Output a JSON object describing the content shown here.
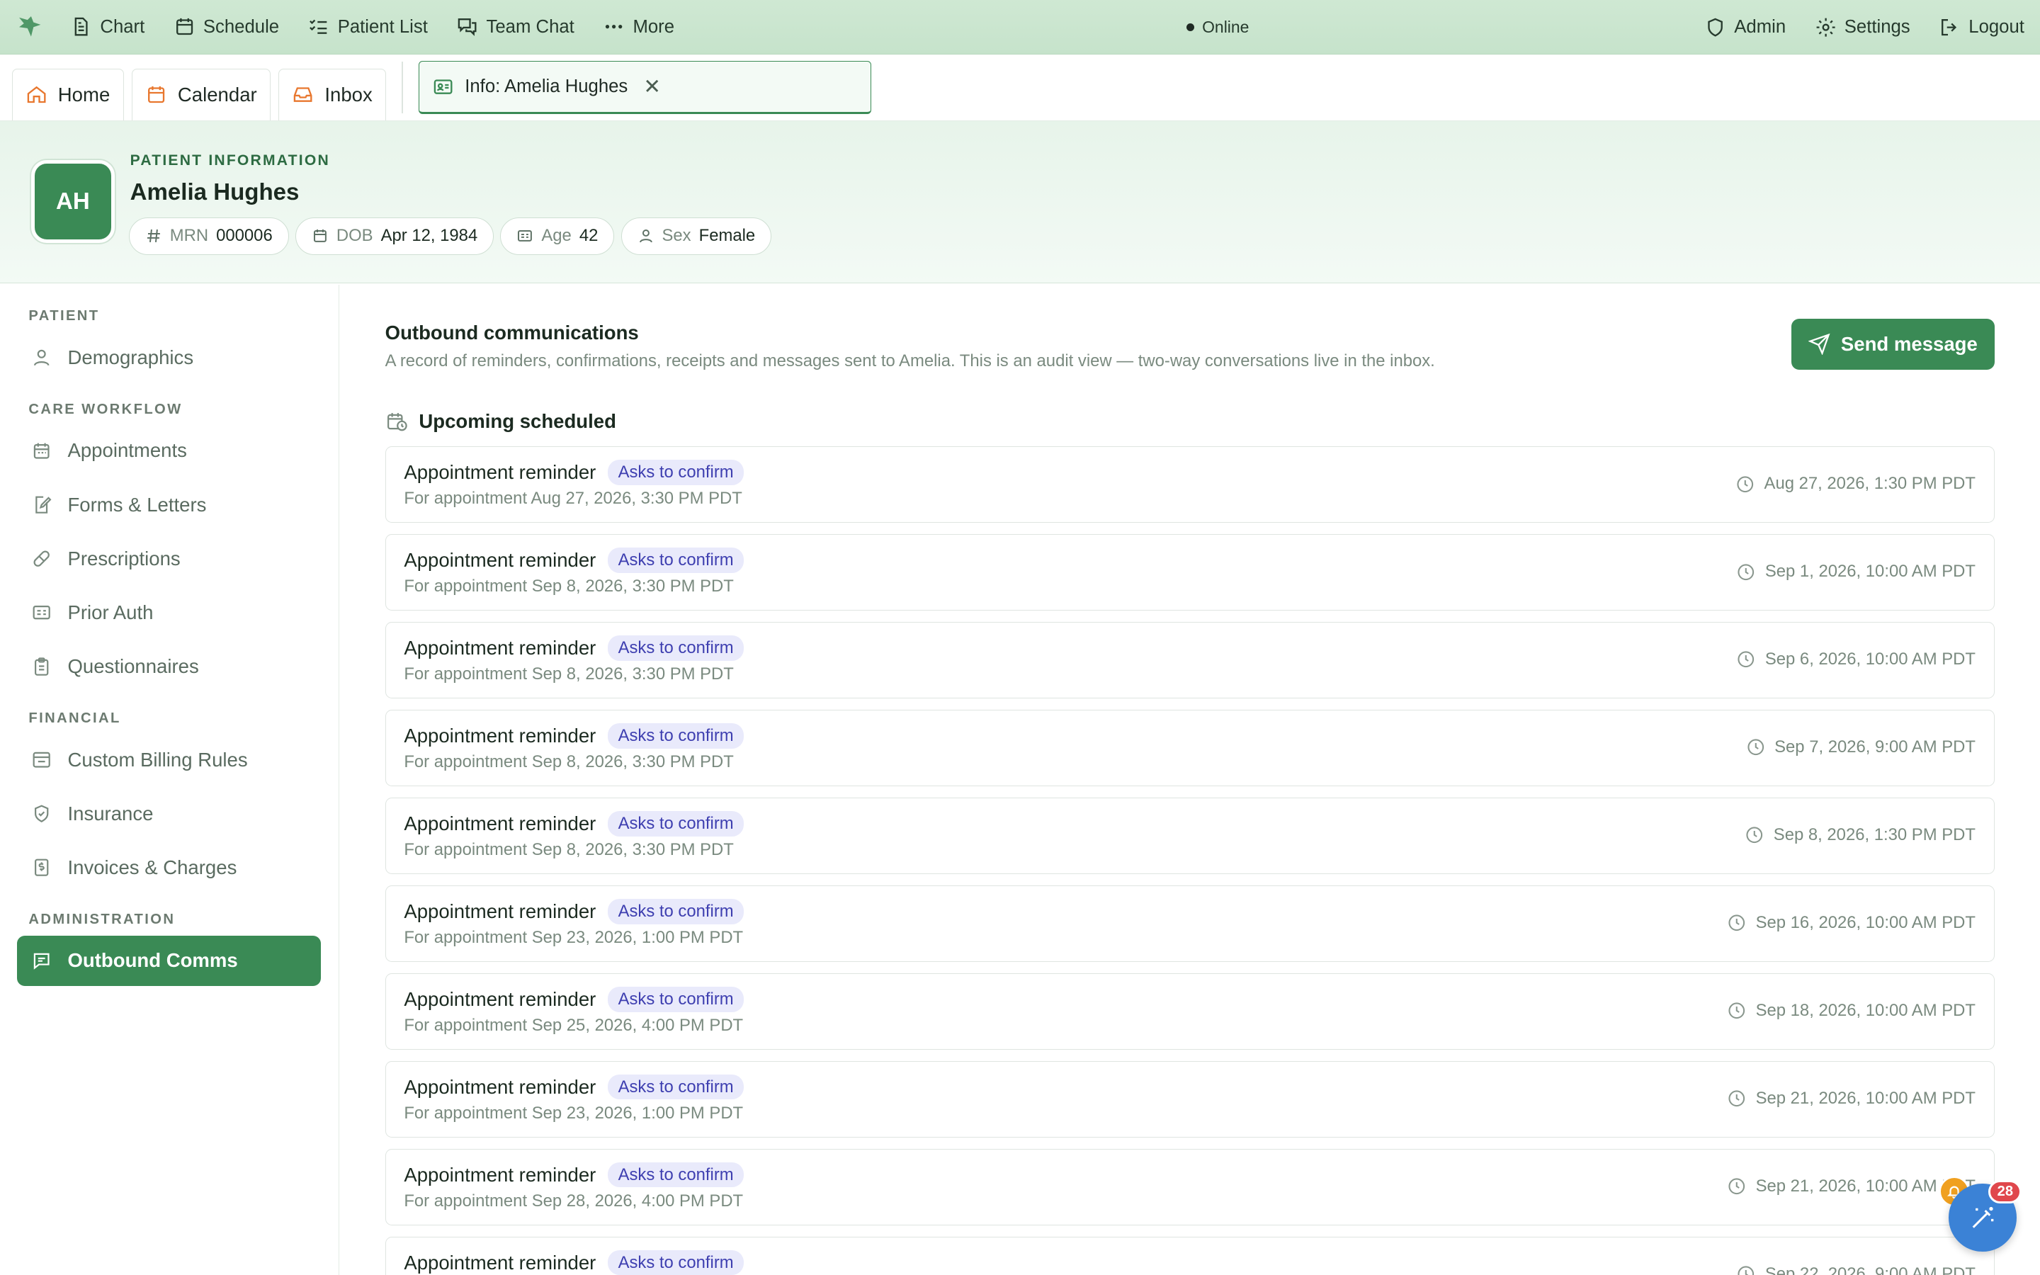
{
  "topbar": {
    "nav": [
      {
        "label": "Chart",
        "icon": "document-icon"
      },
      {
        "label": "Schedule",
        "icon": "calendar-icon"
      },
      {
        "label": "Patient List",
        "icon": "list-check-icon"
      },
      {
        "label": "Team Chat",
        "icon": "chat-bubbles-icon"
      },
      {
        "label": "More",
        "icon": "ellipsis-icon"
      }
    ],
    "status": "Online",
    "right": [
      {
        "label": "Admin",
        "icon": "shield-icon"
      },
      {
        "label": "Settings",
        "icon": "gear-icon"
      },
      {
        "label": "Logout",
        "icon": "logout-icon"
      }
    ]
  },
  "tabs": {
    "items": [
      {
        "label": "Home",
        "icon": "home-icon"
      },
      {
        "label": "Calendar",
        "icon": "calendar-icon"
      },
      {
        "label": "Inbox",
        "icon": "inbox-icon"
      }
    ],
    "active": {
      "label": "Info: Amelia Hughes",
      "icon": "id-card-icon",
      "close": "✕"
    }
  },
  "patient": {
    "section_label": "PATIENT INFORMATION",
    "initials": "AH",
    "name": "Amelia Hughes",
    "chips": {
      "mrn": {
        "key": "MRN",
        "value": "000006"
      },
      "dob": {
        "key": "DOB",
        "value": "Apr 12, 1984"
      },
      "age": {
        "key": "Age",
        "value": "42"
      },
      "sex": {
        "key": "Sex",
        "value": "Female"
      }
    }
  },
  "sidebar": {
    "sections": [
      {
        "title": "PATIENT",
        "items": [
          "Demographics"
        ]
      },
      {
        "title": "CARE WORKFLOW",
        "items": [
          "Appointments",
          "Forms & Letters",
          "Prescriptions",
          "Prior Auth",
          "Questionnaires"
        ]
      },
      {
        "title": "FINANCIAL",
        "items": [
          "Custom Billing Rules",
          "Insurance",
          "Invoices & Charges"
        ]
      },
      {
        "title": "ADMINISTRATION",
        "items": [
          "Outbound Comms"
        ]
      }
    ],
    "active": "Outbound Comms"
  },
  "main": {
    "title": "Outbound communications",
    "subtitle": "A record of reminders, confirmations, receipts and messages sent to Amelia. This is an audit view — two-way conversations live in the inbox.",
    "send_button": "Send message",
    "section_title": "Upcoming scheduled",
    "rows": [
      {
        "title": "Appointment reminder",
        "badge": "Asks to confirm",
        "sub": "For appointment Aug 27, 2026, 3:30 PM PDT",
        "time": "Aug 27, 2026, 1:30 PM PDT"
      },
      {
        "title": "Appointment reminder",
        "badge": "Asks to confirm",
        "sub": "For appointment Sep 8, 2026, 3:30 PM PDT",
        "time": "Sep 1, 2026, 10:00 AM PDT"
      },
      {
        "title": "Appointment reminder",
        "badge": "Asks to confirm",
        "sub": "For appointment Sep 8, 2026, 3:30 PM PDT",
        "time": "Sep 6, 2026, 10:00 AM PDT"
      },
      {
        "title": "Appointment reminder",
        "badge": "Asks to confirm",
        "sub": "For appointment Sep 8, 2026, 3:30 PM PDT",
        "time": "Sep 7, 2026, 9:00 AM PDT"
      },
      {
        "title": "Appointment reminder",
        "badge": "Asks to confirm",
        "sub": "For appointment Sep 8, 2026, 3:30 PM PDT",
        "time": "Sep 8, 2026, 1:30 PM PDT"
      },
      {
        "title": "Appointment reminder",
        "badge": "Asks to confirm",
        "sub": "For appointment Sep 23, 2026, 1:00 PM PDT",
        "time": "Sep 16, 2026, 10:00 AM PDT"
      },
      {
        "title": "Appointment reminder",
        "badge": "Asks to confirm",
        "sub": "For appointment Sep 25, 2026, 4:00 PM PDT",
        "time": "Sep 18, 2026, 10:00 AM PDT"
      },
      {
        "title": "Appointment reminder",
        "badge": "Asks to confirm",
        "sub": "For appointment Sep 23, 2026, 1:00 PM PDT",
        "time": "Sep 21, 2026, 10:00 AM PDT"
      },
      {
        "title": "Appointment reminder",
        "badge": "Asks to confirm",
        "sub": "For appointment Sep 28, 2026, 4:00 PM PDT",
        "time": "Sep 21, 2026, 10:00 AM PDT"
      },
      {
        "title": "Appointment reminder",
        "badge": "Asks to confirm",
        "sub": "",
        "time": "Sep 22, 2026, 9:00 AM PDT"
      }
    ]
  },
  "fab": {
    "count": "28",
    "icon": "magic-wand-icon",
    "bell_icon": "bell-icon"
  },
  "colors": {
    "accent": "#3a8a55",
    "topbar": "#c6e3cb",
    "badge_text": "#3e3fb0",
    "badge_bg": "#e9eafb",
    "fab": "#3b82d6",
    "notif": "#e0474c"
  }
}
